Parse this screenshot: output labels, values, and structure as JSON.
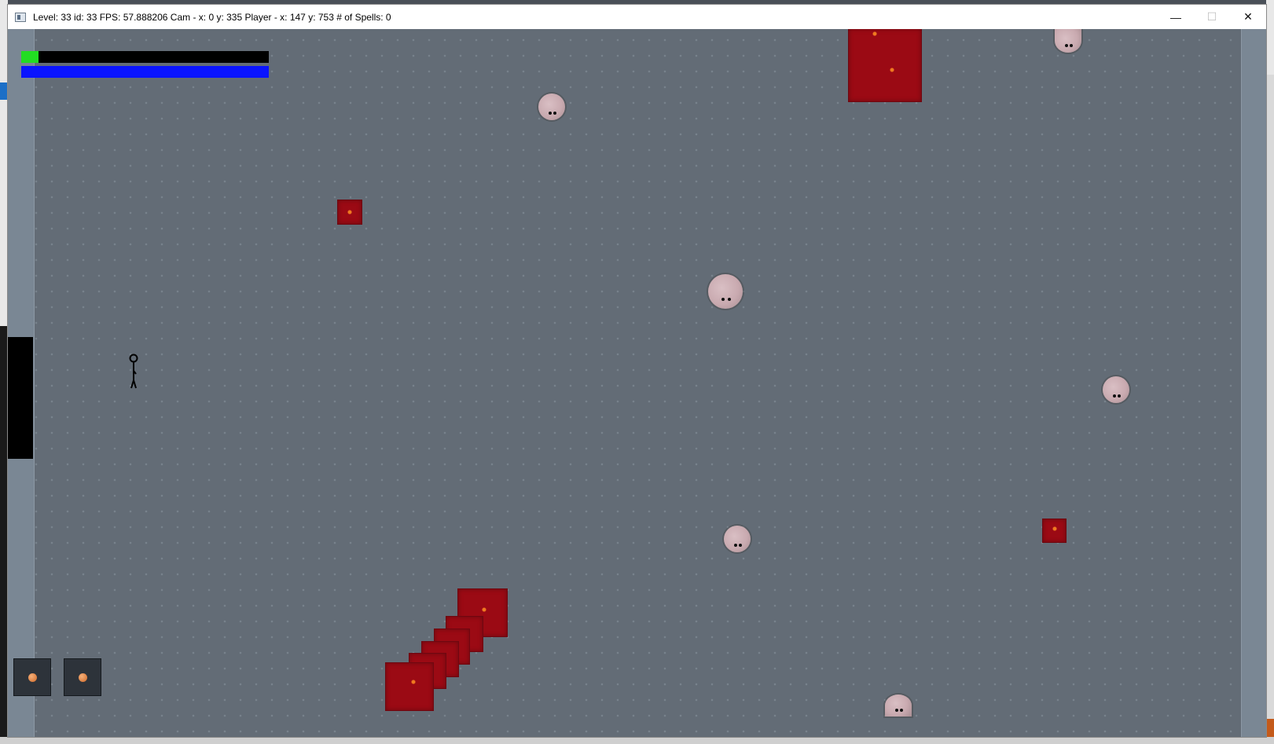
{
  "window": {
    "title": "Level: 33 id: 33 FPS: 57.888206 Cam - x: 0 y: 335 Player - x: 147 y: 753 # of Spells: 0",
    "minimize_glyph": "—",
    "maximize_glyph": "☐",
    "close_glyph": "✕"
  },
  "hud": {
    "health_fraction": 0.07,
    "mana_fraction": 1.0,
    "health_color": "#22dd22",
    "mana_color": "#0a14ff"
  },
  "inventory": {
    "slots": [
      {
        "item": "orange-orb"
      },
      {
        "item": "orange-orb"
      }
    ]
  },
  "colors": {
    "floor": "#636c76",
    "wall": "#7a8794",
    "blood": "#9b0a14"
  }
}
